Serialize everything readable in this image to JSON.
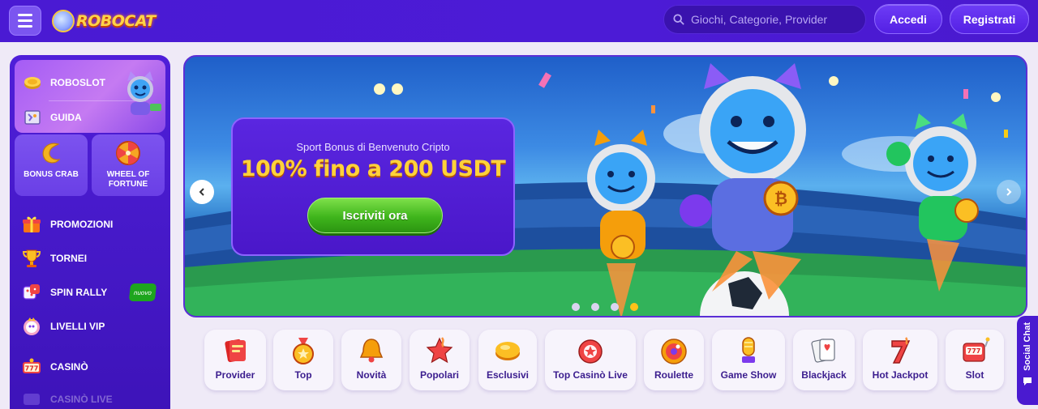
{
  "header": {
    "logo_text": "ROBOCAT",
    "search_placeholder": "Giochi, Categorie, Provider",
    "login_label": "Accedi",
    "register_label": "Registrati"
  },
  "sidebar": {
    "robo_items": [
      {
        "label": "ROBOSLOT",
        "icon": "coin-icon"
      },
      {
        "label": "GUIDA",
        "icon": "map-icon"
      }
    ],
    "tiles": [
      {
        "label": "BONUS CRAB",
        "icon": "crab-claw-icon"
      },
      {
        "label": "WHEEL OF FORTUNE",
        "icon": "wheel-icon"
      }
    ],
    "items": [
      {
        "label": "PROMOZIONI",
        "icon": "gift-icon"
      },
      {
        "label": "TORNEI",
        "icon": "trophy-icon"
      },
      {
        "label": "SPIN RALLY",
        "icon": "dice-icon"
      },
      {
        "label": "LIVELLI VIP",
        "icon": "vip-icon"
      },
      {
        "label": "CASINÒ",
        "icon": "slot-777-icon"
      },
      {
        "label": "CASINÒ LIVE",
        "icon": "live-icon"
      }
    ],
    "new_badge": "nuovo"
  },
  "banner": {
    "subtitle": "Sport Bonus di Benvenuto Cripto",
    "title": "100% fino a 200 USDT",
    "cta_label": "Iscriviti ora",
    "slides": 4,
    "active_slide": 4
  },
  "categories": [
    {
      "label": "Provider",
      "icon": "provider-cards-icon"
    },
    {
      "label": "Top",
      "icon": "medal-icon"
    },
    {
      "label": "Novità",
      "icon": "bell-icon"
    },
    {
      "label": "Popolari",
      "icon": "star-icon"
    },
    {
      "label": "Esclusivi",
      "icon": "gem-icon"
    },
    {
      "label": "Top Casinò Live",
      "icon": "chip-icon"
    },
    {
      "label": "Roulette",
      "icon": "roulette-icon"
    },
    {
      "label": "Game Show",
      "icon": "microphone-icon"
    },
    {
      "label": "Blackjack",
      "icon": "cards-icon"
    },
    {
      "label": "Hot Jackpot",
      "icon": "seven-icon"
    },
    {
      "label": "Slot",
      "icon": "slot-machine-icon"
    }
  ],
  "social_chat": {
    "label": "Social Chat"
  },
  "colors": {
    "header_bg": "#4a1ad3",
    "accent": "#ffc21a",
    "cta_green": "#3fb51c",
    "sidebar_bg": "#4a1ad0"
  }
}
